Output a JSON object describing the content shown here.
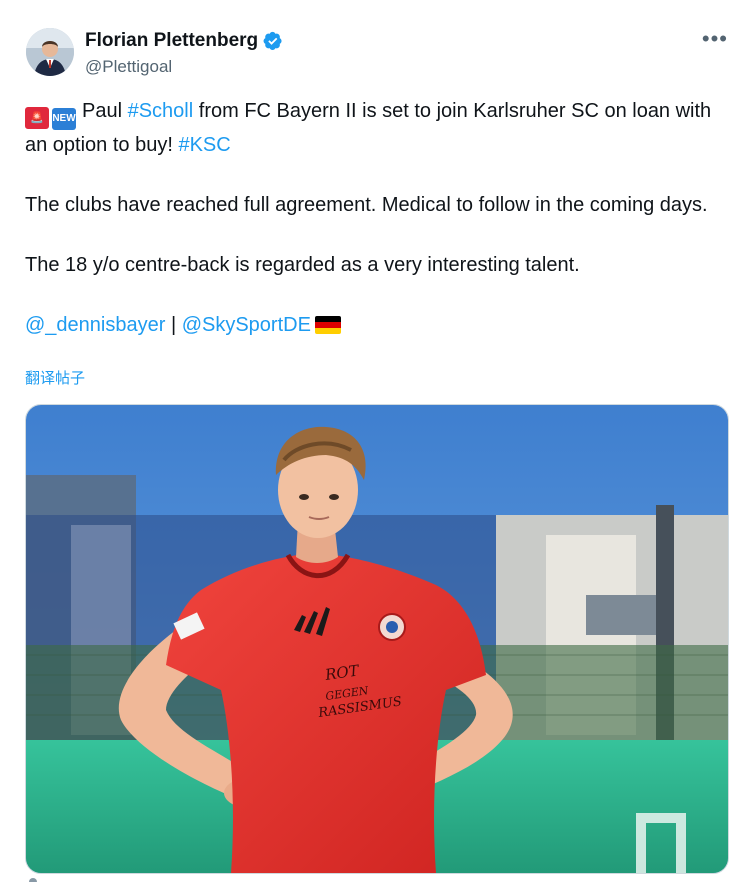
{
  "author": {
    "display_name": "Florian Plettenberg",
    "handle": "@Plettigoal"
  },
  "menu": {
    "more_label": "•••"
  },
  "post": {
    "emoji_siren": "🚨",
    "emoji_new": "NEW",
    "line1_pre": "Paul ",
    "hashtag_scholl": "#Scholl",
    "line1_post": " from FC Bayern II is set to join Karlsruher SC on loan with an option to buy! ",
    "hashtag_ksc": "#KSC",
    "para2": "The clubs have reached full agreement. Medical to follow in the coming days.",
    "para3": "The 18 y/o centre-back is regarded as a very interesting talent.",
    "mention1": "@_dennisbayer",
    "separator": " | ",
    "mention2": "@SkySportDE",
    "flag_icon": "germany-flag"
  },
  "translate_label": "翻译帖子",
  "media": {
    "alt": "Player in red FC Bayern training shirt with hands on hips",
    "shirt_print": "ROT GEGEN RASSISMUS",
    "colors": {
      "sky": "#4f8fd6",
      "shirt": "#e8312f",
      "turf": "#2fb891"
    }
  }
}
